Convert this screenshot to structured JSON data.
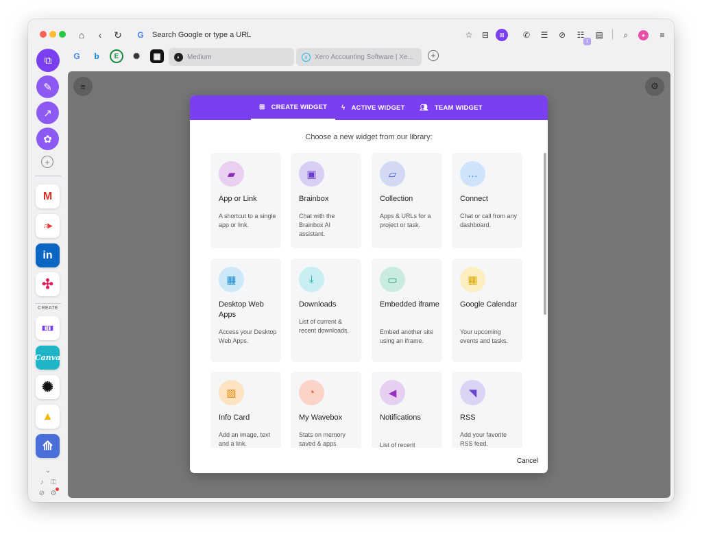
{
  "browser": {
    "url_placeholder": "Search Google or type a URL",
    "badge_count": "1",
    "bookmarks": [
      {
        "name": "google",
        "glyph": "G",
        "color": "#4285f4"
      },
      {
        "name": "bing",
        "glyph": "b",
        "color": "#0a84d6"
      },
      {
        "name": "evernote",
        "glyph": "E",
        "color": "#1a8a3a"
      },
      {
        "name": "chatgpt",
        "glyph": "✺",
        "color": "#333333"
      },
      {
        "name": "apps-grid",
        "glyph": "▦",
        "color": "#111111"
      }
    ],
    "tabs": [
      "Medium",
      "Xero Accounting Software | Xe..."
    ]
  },
  "sidebar": {
    "create_label": "CREATE"
  },
  "modal": {
    "tabs": [
      {
        "label": "CREATE WIDGET",
        "icon": "plus-square-icon"
      },
      {
        "label": "ACTIVE WIDGET",
        "icon": "bolt-icon"
      },
      {
        "label": "TEAM WIDGET",
        "icon": "team-icon"
      }
    ],
    "subtitle": "Choose a new widget from our library:",
    "cancel": "Cancel",
    "widgets": [
      {
        "title": "App or Link",
        "desc": "A shortcut to a single app or link.",
        "icon": "folder-icon",
        "bg": "#ead0f0",
        "fg": "#8a2fb0"
      },
      {
        "title": "Brainbox",
        "desc": "Chat with the Brainbox AI assistant.",
        "icon": "brainbox-icon",
        "bg": "#d9cff5",
        "fg": "#6b3fd6"
      },
      {
        "title": "Collection",
        "desc": "Apps & URLs for a project or task.",
        "icon": "folder-open-icon",
        "bg": "#d3d8f3",
        "fg": "#3f5bd6"
      },
      {
        "title": "Connect",
        "desc": "Chat or call from any dashboard.",
        "icon": "chat-icon",
        "bg": "#cfe3fa",
        "fg": "#2f86e0"
      },
      {
        "title": "Desktop Web Apps",
        "desc": "Access your Desktop Web Apps.",
        "icon": "grid-icon",
        "bg": "#cde9f8",
        "fg": "#1f8fd0"
      },
      {
        "title": "Downloads",
        "desc": "List of current & recent downloads.",
        "icon": "download-icon",
        "bg": "#c9eef2",
        "fg": "#1aa9bb"
      },
      {
        "title": "Embedded iframe",
        "desc": "Embed another site using an iframe.",
        "icon": "browser-icon",
        "bg": "#c9ebe0",
        "fg": "#2a9a7a"
      },
      {
        "title": "Google Calendar",
        "desc": "Your upcoming events and tasks.",
        "icon": "calendar-icon",
        "bg": "#fbefc0",
        "fg": "#e0a800"
      },
      {
        "title": "Info Card",
        "desc": "Add an image, text and a link.",
        "icon": "image-icon",
        "bg": "#fde3c0",
        "fg": "#e58a10"
      },
      {
        "title": "My Wavebox",
        "desc": "Stats on memory saved & apps",
        "icon": "pie-chart-icon",
        "bg": "#fbd3c8",
        "fg": "#e5582a"
      },
      {
        "title": "Notifications",
        "desc": "List of recent notifications.",
        "icon": "megaphone-icon",
        "bg": "#e6d0f2",
        "fg": "#9a30c0"
      },
      {
        "title": "RSS",
        "desc": "Add your favorite RSS feed.",
        "icon": "rss-icon",
        "bg": "#dcd4f4",
        "fg": "#6a46d0"
      }
    ]
  }
}
